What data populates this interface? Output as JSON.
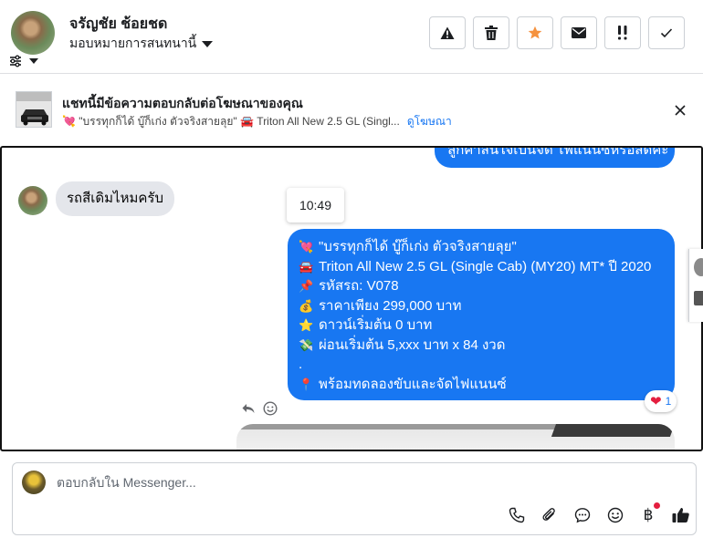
{
  "header": {
    "contact_name": "จรัญชัย ช้อยชด",
    "assign_label": "มอบหมายการสนทนานี้",
    "toolbar": [
      {
        "name": "warning-button",
        "icon": "warning-icon"
      },
      {
        "name": "delete-button",
        "icon": "trash-icon"
      },
      {
        "name": "star-button",
        "icon": "star-icon"
      },
      {
        "name": "mark-unread-button",
        "icon": "envelope-icon"
      },
      {
        "name": "mark-urgent-button",
        "icon": "double-exclamation-icon"
      },
      {
        "name": "mark-done-button",
        "icon": "check-icon"
      }
    ],
    "accent_star": "#f5923e"
  },
  "ad_banner": {
    "title": "แชทนี้มีข้อความตอบกลับต่อโฆษณาของคุณ",
    "subtitle": "💘 \"บรรทุกก็ได้ บู๊ก็เก่ง ตัวจริงสายลุย\" 🚘 Triton All New 2.5 GL (Singl...",
    "link": "ดูโฆษณา"
  },
  "chat": {
    "top_bubble_text": "ลูกค้าสนใจเป็นจัด ไฟแนนซ์หรือสดคะ",
    "incoming_text": "รถสีเดิมไหมครับ",
    "timestamp": "10:49",
    "outgoing_lines": [
      {
        "emoji": "💘",
        "text": "\"บรรทุกก็ได้ บู๊ก็เก่ง ตัวจริงสายลุย\""
      },
      {
        "emoji": "🚘",
        "text": "Triton All New 2.5 GL (Single Cab) (MY20) MT* ปี 2020"
      },
      {
        "emoji": "📌",
        "text": "รหัสรถ: V078"
      },
      {
        "emoji": "💰",
        "text": "ราคาเพียง 299,000 บาท"
      },
      {
        "emoji": "⭐",
        "text": "ดาวน์เริ่มต้น 0 บาท"
      },
      {
        "emoji": "💸",
        "text": "ผ่อนเริ่มต้น 5,xxx บาท x 84 งวด"
      },
      {
        "emoji": "",
        "text": "."
      },
      {
        "emoji": "📍",
        "text": "พร้อมทดลองขับและจัดไฟแนนซ์"
      }
    ],
    "reaction": {
      "emoji": "❤️",
      "count": "1"
    },
    "bubble_color": "#1877f2"
  },
  "composer": {
    "placeholder": "ตอบกลับใน Messenger...",
    "icons": [
      "phone-icon",
      "paperclip-icon",
      "chat-bubble-icon",
      "emoji-icon",
      "baht-icon",
      "thumbs-up-icon"
    ],
    "baht_symbol": "฿"
  }
}
